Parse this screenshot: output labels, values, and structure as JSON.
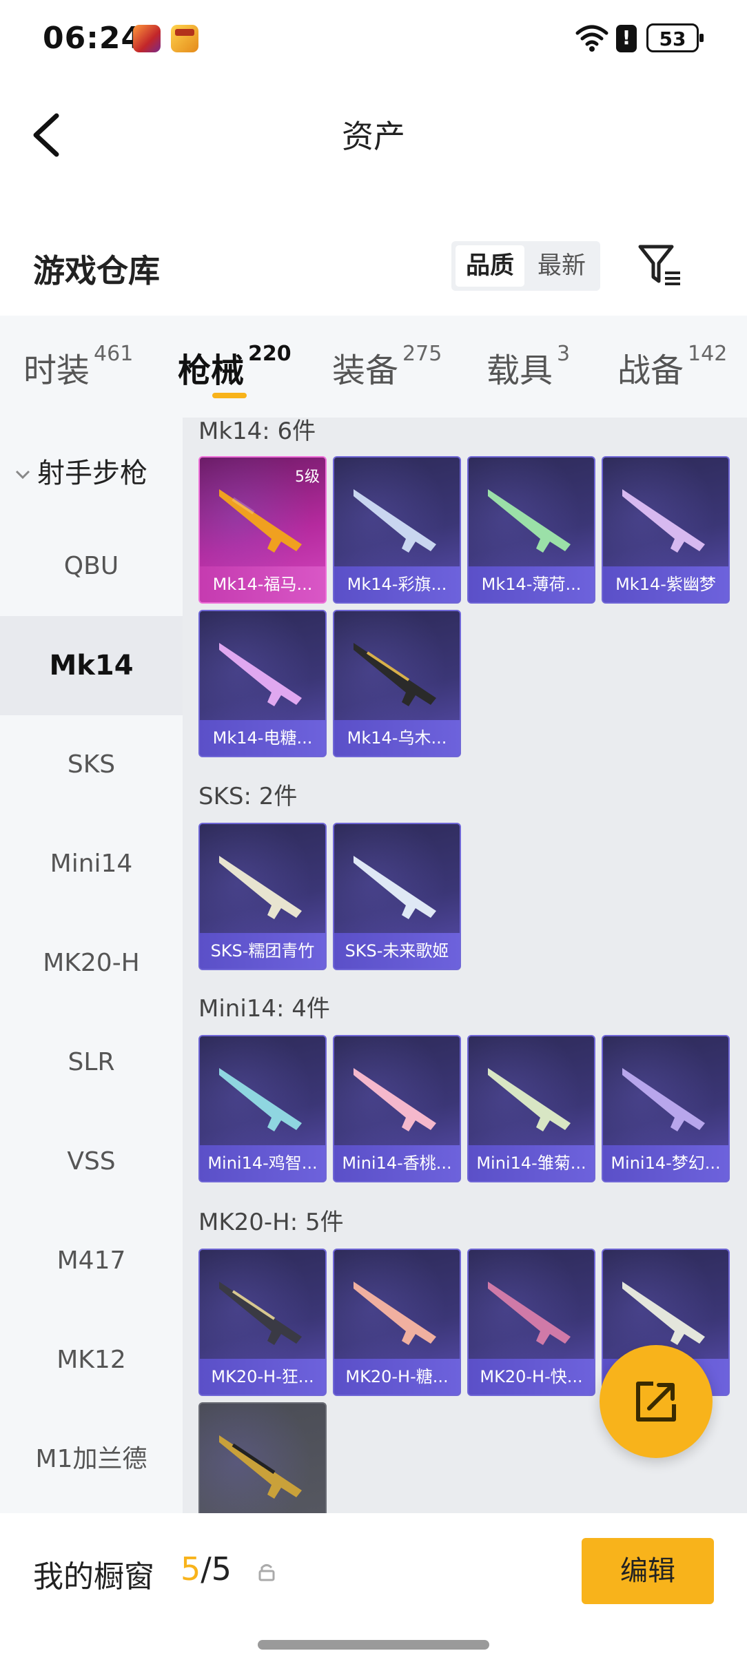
{
  "status_bar": {
    "time": "06:24",
    "battery": "53"
  },
  "header": {
    "title": "资产"
  },
  "section": {
    "title": "游戏仓库",
    "sort_options": [
      "品质",
      "最新"
    ]
  },
  "category_tabs": [
    {
      "label": "时装",
      "count": "461"
    },
    {
      "label": "枪械",
      "count": "220"
    },
    {
      "label": "装备",
      "count": "275"
    },
    {
      "label": "载具",
      "count": "3"
    },
    {
      "label": "战备",
      "count": "142"
    }
  ],
  "sidebar": {
    "group_label": "射手步枪",
    "items": [
      "QBU",
      "Mk14",
      "SKS",
      "Mini14",
      "MK20-H",
      "SLR",
      "VSS",
      "M417",
      "MK12",
      "M1加兰德"
    ],
    "active_item": "Mk14"
  },
  "groups": [
    {
      "header": "Mk14: 6件",
      "items": [
        {
          "name": "Mk14-福马...",
          "badge": "5级",
          "rarity": "pink"
        },
        {
          "name": "Mk14-彩旗...",
          "rarity": "purple"
        },
        {
          "name": "Mk14-薄荷...",
          "rarity": "purple"
        },
        {
          "name": "Mk14-紫幽梦",
          "rarity": "purple"
        },
        {
          "name": "Mk14-电糖...",
          "rarity": "purple"
        },
        {
          "name": "Mk14-乌木...",
          "rarity": "purple"
        }
      ]
    },
    {
      "header": "SKS: 2件",
      "items": [
        {
          "name": "SKS-糯团青竹",
          "rarity": "purple"
        },
        {
          "name": "SKS-未来歌姬",
          "rarity": "purple"
        }
      ]
    },
    {
      "header": "Mini14: 4件",
      "items": [
        {
          "name": "Mini14-鸡智...",
          "rarity": "purple"
        },
        {
          "name": "Mini14-香桃...",
          "rarity": "purple"
        },
        {
          "name": "Mini14-雏菊...",
          "rarity": "purple"
        },
        {
          "name": "Mini14-梦幻...",
          "rarity": "purple"
        }
      ]
    },
    {
      "header": "MK20-H: 5件",
      "items": [
        {
          "name": "MK20-H-狂...",
          "rarity": "purple"
        },
        {
          "name": "MK20-H-糖...",
          "rarity": "purple"
        },
        {
          "name": "MK20-H-快...",
          "rarity": "purple"
        },
        {
          "name": "MK20-H-...",
          "rarity": "purple"
        },
        {
          "name": "",
          "rarity": "gray"
        }
      ]
    }
  ],
  "showcase": {
    "label": "我的橱窗",
    "current": "5",
    "total": "/5",
    "edit_label": "编辑"
  },
  "colors": {
    "accent": "#f8b31b",
    "card_purple": "#3b3676",
    "card_pink": "#b52a9e"
  }
}
